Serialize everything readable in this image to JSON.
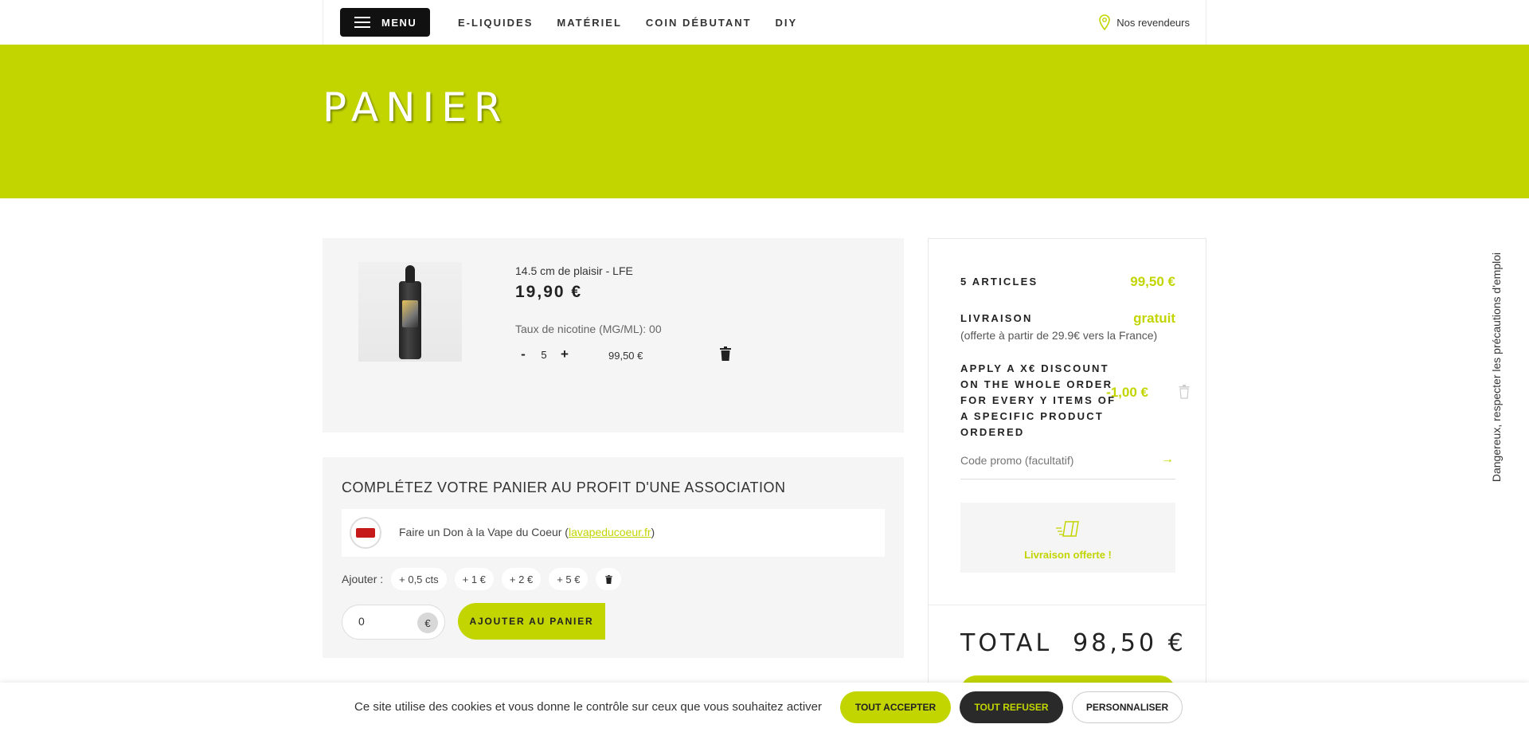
{
  "header": {
    "menu_label": "MENU",
    "nav": [
      "E-LIQUIDES",
      "MATÉRIEL",
      "COIN DÉBUTANT",
      "DIY"
    ],
    "dealers_label": "Nos revendeurs"
  },
  "hero": {
    "title": "PANIER"
  },
  "cart_item": {
    "name": "14.5 cm de plaisir - LFE",
    "price": "19,90 €",
    "nicotine": "Taux de nicotine (MG/ML): 00",
    "minus": "-",
    "quantity": "5",
    "plus": "+",
    "line_total": "99,50 €"
  },
  "donation": {
    "title": "COMPLÉTEZ VOTRE PANIER AU PROFIT D'UNE ASSOCIATION",
    "text_prefix": "Faire un Don à la Vape du Coeur (",
    "link": "lavapeducoeur.fr",
    "text_suffix": ")",
    "add_label": "Ajouter :",
    "chips": [
      "+ 0,5 cts",
      "+ 1 €",
      "+ 2 €",
      "+ 5 €"
    ],
    "amount_value": "0",
    "currency": "€",
    "add_button": "AJOUTER AU PANIER"
  },
  "summary": {
    "articles_label": "5 ARTICLES",
    "articles_value": "99,50 €",
    "delivery_label": "LIVRAISON",
    "delivery_value": "gratuit",
    "delivery_note": "(offerte à partir de 29.9€ vers la France)",
    "discount_label": "APPLY A X€ DISCOUNT ON THE WHOLE ORDER FOR EVERY Y ITEMS OF A SPECIFIC PRODUCT ORDERED",
    "discount_value": "-1,00 €",
    "promo_placeholder": "Code promo (facultatif)",
    "promo_arrow": "→",
    "free_shipping": "Livraison offerte !",
    "total_label": "TOTAL",
    "total_value": "98,50 €"
  },
  "side_notice": "Dangereux, respecter les précautions d'emploi",
  "cookie": {
    "message": "Ce site utilise des cookies et vous donne le contrôle sur ceux que vous souhaitez activer",
    "accept": "TOUT ACCEPTER",
    "refuse": "TOUT REFUSER",
    "customize": "PERSONNALISER"
  },
  "colors": {
    "accent": "#c2d500",
    "dark": "#111111",
    "panel": "#f5f5f5"
  }
}
